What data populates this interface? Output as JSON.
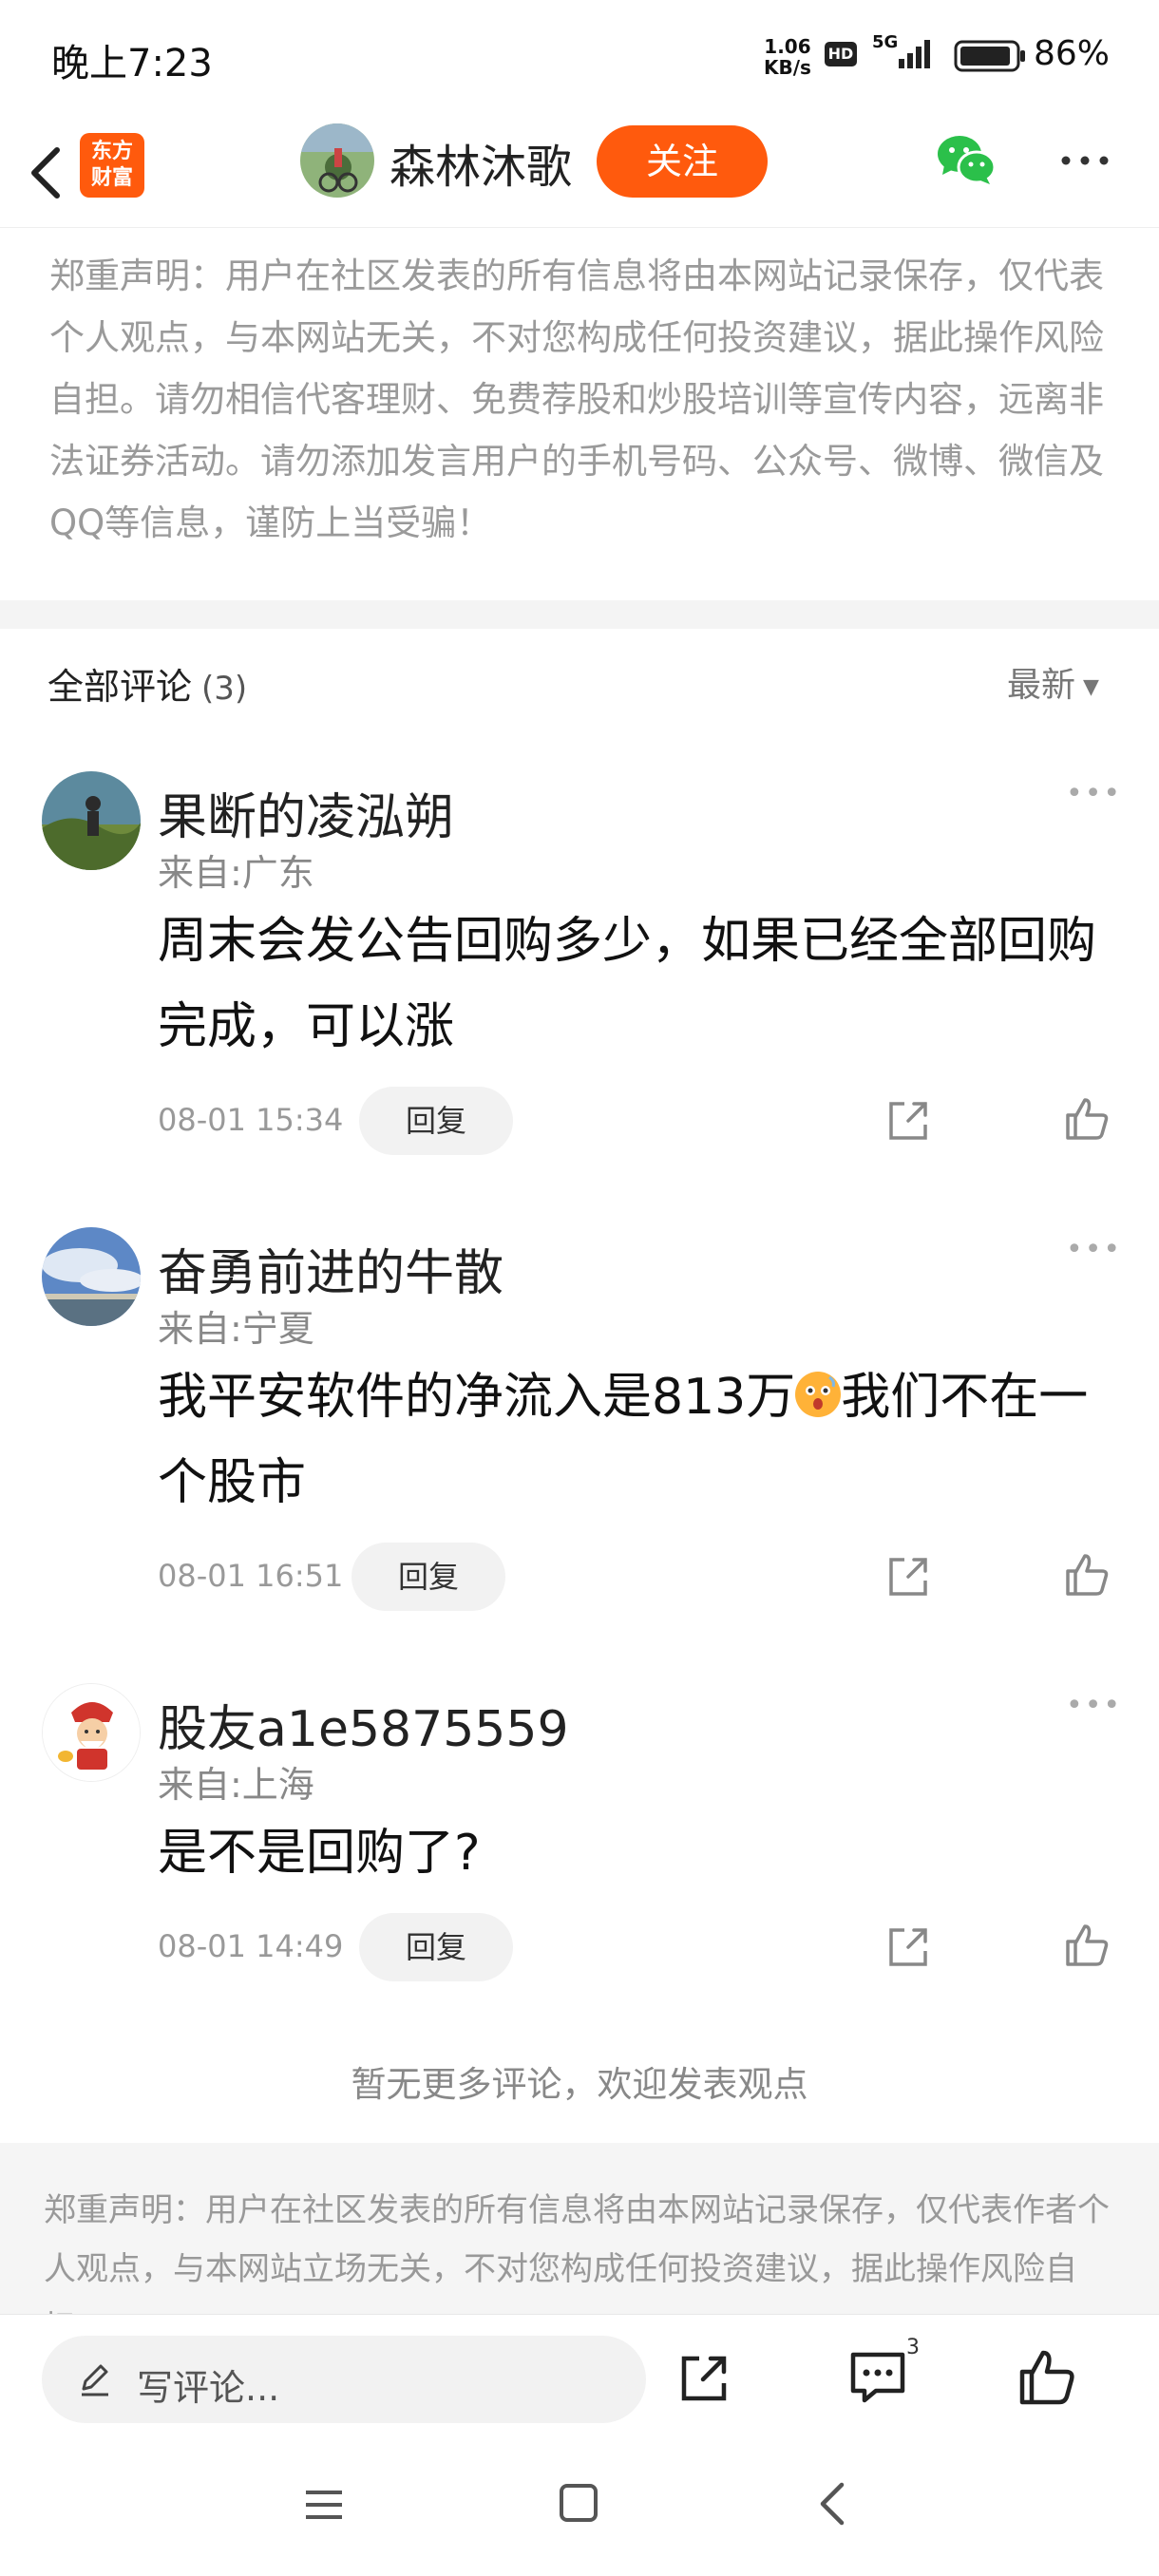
{
  "status_bar": {
    "time": "晚上7:23",
    "net_speed_value": "1.06",
    "net_speed_unit": "KB/s",
    "hd": "HD",
    "network": "5G",
    "battery": "86%"
  },
  "header": {
    "logo_line1": "东方",
    "logo_line2": "财富",
    "author_name": "森林沐歌",
    "follow_label": "关注"
  },
  "disclaimer": "郑重声明：用户在社区发表的所有信息将由本网站记录保存，仅代表个人观点，与本网站无关，不对您构成任何投资建议，据此操作风险自担。请勿相信代客理财、免费荐股和炒股培训等宣传内容，远离非法证券活动。请勿添加发言用户的手机号码、公众号、微博、微信及QQ等信息，谨防上当受骗！",
  "comments_section": {
    "title": "全部评论",
    "count": "(3)",
    "sort_label": "最新"
  },
  "comments": [
    {
      "name": "果断的凌泓朔",
      "location": "来自:广东",
      "text": "周末会发公告回购多少，如果已经全部回购完成，可以涨",
      "time": "08-01 15:34",
      "reply_label": "回复"
    },
    {
      "name": "奋勇前进的牛散",
      "location": "来自:宁夏",
      "text_before": "我平安软件的净流入是813万",
      "text_after": "我们不在一个股市",
      "time": "08-01 16:51",
      "reply_label": "回复"
    },
    {
      "name": "股友a1e5875559",
      "location": "来自:上海",
      "text": "是不是回购了?",
      "time": "08-01 14:49",
      "reply_label": "回复"
    }
  ],
  "no_more_text": "暂无更多评论，欢迎发表观点",
  "footer_disclaimer": "郑重声明：用户在社区发表的所有信息将由本网站记录保存，仅代表作者个人观点，与本网站立场无关，不对您构成任何投资建议，据此操作风险自担。",
  "bottom_bar": {
    "input_placeholder": "写评论...",
    "comment_count": "3"
  },
  "colors": {
    "accent": "#ff5a0d",
    "wechat": "#2bc04a"
  }
}
